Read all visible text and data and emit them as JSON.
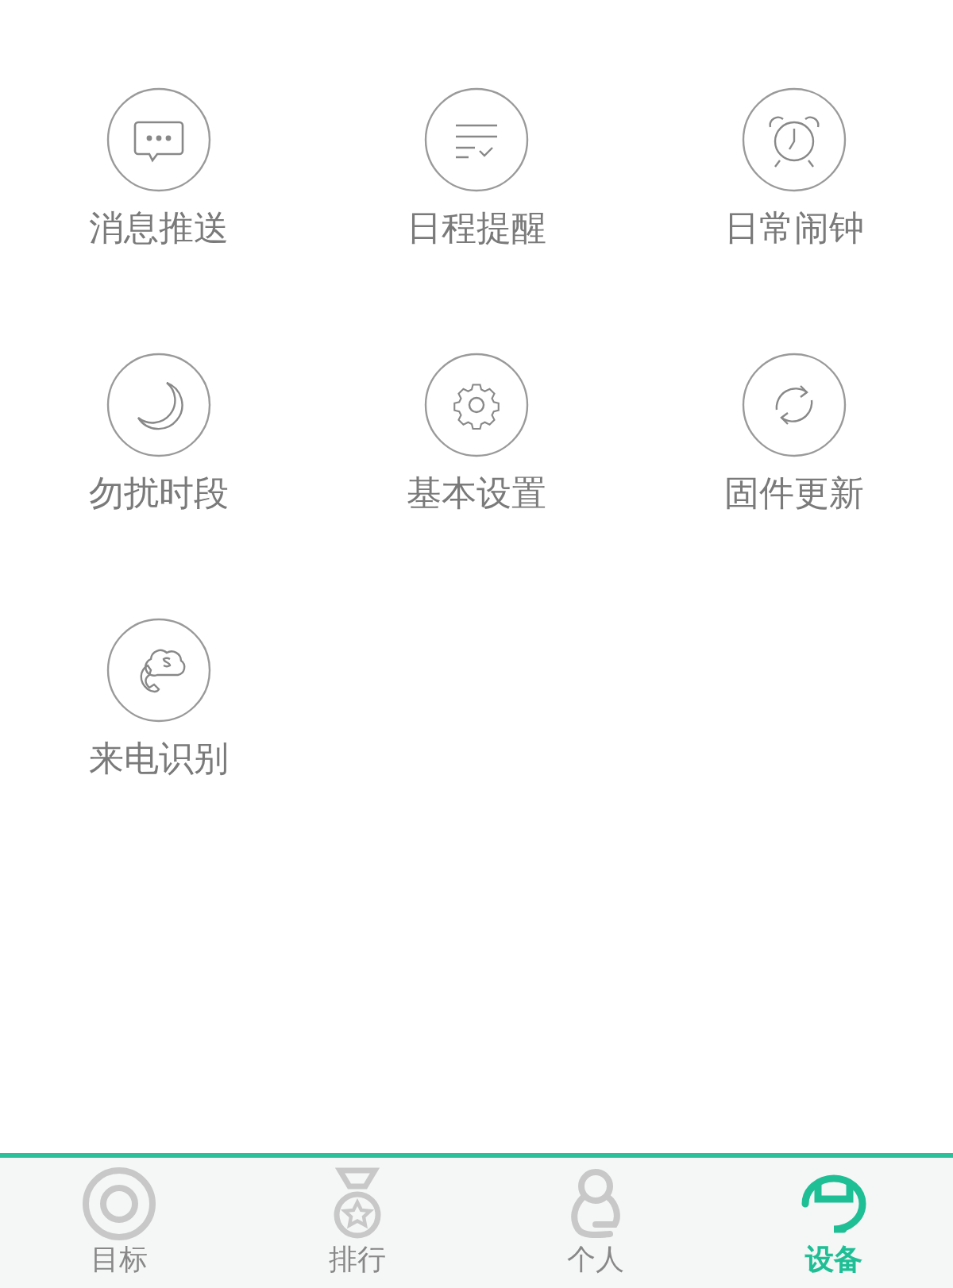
{
  "features": [
    {
      "label": "消息推送"
    },
    {
      "label": "日程提醒"
    },
    {
      "label": "日常闹钟"
    },
    {
      "label": "勿扰时段"
    },
    {
      "label": "基本设置"
    },
    {
      "label": "固件更新"
    },
    {
      "label": "来电识别"
    }
  ],
  "tab_bar": [
    {
      "label": "目标",
      "selected": false
    },
    {
      "label": "排行",
      "selected": false
    },
    {
      "label": "个人",
      "selected": false
    },
    {
      "label": "设备",
      "selected": true
    }
  ]
}
